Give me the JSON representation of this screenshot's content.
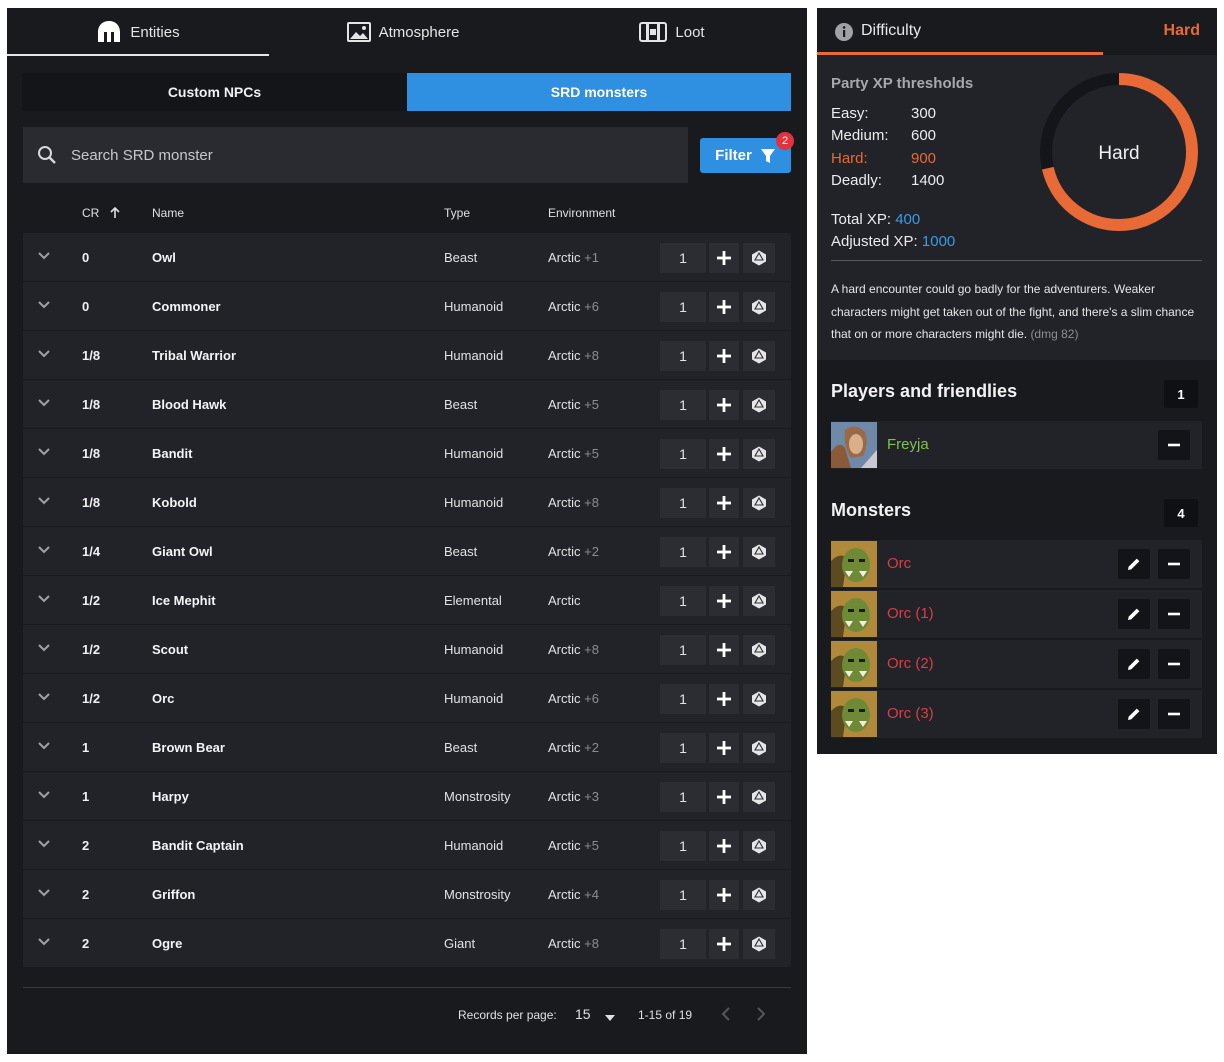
{
  "tabs": [
    {
      "label": "Entities",
      "icon": "helmet-icon"
    },
    {
      "label": "Atmosphere",
      "icon": "image-icon"
    },
    {
      "label": "Loot",
      "icon": "chest-icon"
    }
  ],
  "subtabs": {
    "custom": "Custom NPCs",
    "srd": "SRD monsters"
  },
  "search": {
    "placeholder": "Search SRD monster"
  },
  "filter": {
    "label": "Filter",
    "badge": "2"
  },
  "columns": {
    "cr": "CR",
    "name": "Name",
    "type": "Type",
    "environment": "Environment"
  },
  "monsters": [
    {
      "cr": "0",
      "name": "Owl",
      "type": "Beast",
      "env": "Arctic",
      "extra": "+1",
      "qty": "1"
    },
    {
      "cr": "0",
      "name": "Commoner",
      "type": "Humanoid",
      "env": "Arctic",
      "extra": "+6",
      "qty": "1"
    },
    {
      "cr": "1/8",
      "name": "Tribal Warrior",
      "type": "Humanoid",
      "env": "Arctic",
      "extra": "+8",
      "qty": "1"
    },
    {
      "cr": "1/8",
      "name": "Blood Hawk",
      "type": "Beast",
      "env": "Arctic",
      "extra": "+5",
      "qty": "1"
    },
    {
      "cr": "1/8",
      "name": "Bandit",
      "type": "Humanoid",
      "env": "Arctic",
      "extra": "+5",
      "qty": "1"
    },
    {
      "cr": "1/8",
      "name": "Kobold",
      "type": "Humanoid",
      "env": "Arctic",
      "extra": "+8",
      "qty": "1"
    },
    {
      "cr": "1/4",
      "name": "Giant Owl",
      "type": "Beast",
      "env": "Arctic",
      "extra": "+2",
      "qty": "1"
    },
    {
      "cr": "1/2",
      "name": "Ice Mephit",
      "type": "Elemental",
      "env": "Arctic",
      "extra": "",
      "qty": "1"
    },
    {
      "cr": "1/2",
      "name": "Scout",
      "type": "Humanoid",
      "env": "Arctic",
      "extra": "+8",
      "qty": "1"
    },
    {
      "cr": "1/2",
      "name": "Orc",
      "type": "Humanoid",
      "env": "Arctic",
      "extra": "+6",
      "qty": "1"
    },
    {
      "cr": "1",
      "name": "Brown Bear",
      "type": "Beast",
      "env": "Arctic",
      "extra": "+2",
      "qty": "1"
    },
    {
      "cr": "1",
      "name": "Harpy",
      "type": "Monstrosity",
      "env": "Arctic",
      "extra": "+3",
      "qty": "1"
    },
    {
      "cr": "2",
      "name": "Bandit Captain",
      "type": "Humanoid",
      "env": "Arctic",
      "extra": "+5",
      "qty": "1"
    },
    {
      "cr": "2",
      "name": "Griffon",
      "type": "Monstrosity",
      "env": "Arctic",
      "extra": "+4",
      "qty": "1"
    },
    {
      "cr": "2",
      "name": "Ogre",
      "type": "Giant",
      "env": "Arctic",
      "extra": "+8",
      "qty": "1"
    }
  ],
  "pagination": {
    "per_page_label": "Records per page:",
    "per_page": "15",
    "range": "1-15 of 19"
  },
  "difficulty": {
    "title": "Difficulty",
    "level": "Hard",
    "thresholds_title": "Party XP thresholds",
    "thresholds": [
      {
        "label": "Easy:",
        "value": "300"
      },
      {
        "label": "Medium:",
        "value": "600"
      },
      {
        "label": "Hard:",
        "value": "900"
      },
      {
        "label": "Deadly:",
        "value": "1400"
      }
    ],
    "total_label": "Total XP:",
    "total": "400",
    "adjusted_label": "Adjusted XP:",
    "adjusted": "1000",
    "ring_fill": 0.714,
    "description": "A hard encounter could go badly for the adventurers. Weaker characters might get taken out of the fight, and there's a slim chance that on or more characters might die.",
    "ref": "(dmg 82)",
    "accent": "#e86a36"
  },
  "players": {
    "title": "Players and friendlies",
    "count": "1",
    "items": [
      {
        "name": "Freyja"
      }
    ]
  },
  "monsters_panel": {
    "title": "Monsters",
    "count": "4",
    "items": [
      {
        "name": "Orc"
      },
      {
        "name": "Orc (1)"
      },
      {
        "name": "Orc (2)"
      },
      {
        "name": "Orc (3)"
      }
    ]
  }
}
